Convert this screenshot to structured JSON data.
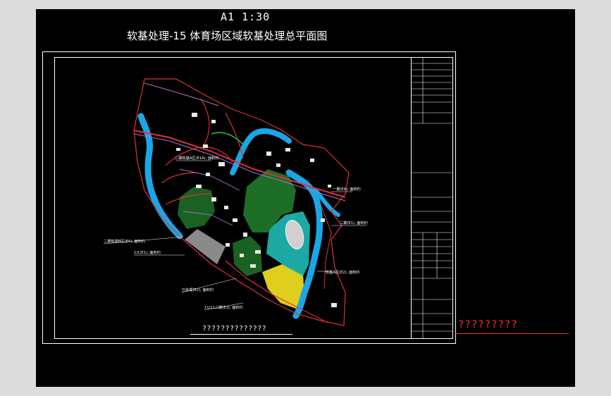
{
  "sheet": {
    "scale_label": "A1 1:30",
    "title": "软基处理-15 体育场区域软基处理总平面图"
  },
  "plan": {
    "caption": "??????????????",
    "red_note": "?????????",
    "zone_labels": [
      "二期软基A区(E1A),  面积约",
      "二期软基B区(E4),  面积约",
      "1/1(E1),  面积约",
      "已处理(E2), 面积约",
      "11/11二期(E3), 面积约",
      "一期(E4), 面积约",
      "二期(E1), 面积约",
      "软基A区(E2), 面积约"
    ]
  },
  "colors": {
    "background": "#000000",
    "frame": "#ffffff",
    "road_red": "#e0303a",
    "water_blue": "#1aa6e6",
    "vegetation_green": "#2bbf3c",
    "zone_cyan": "#22c6c0",
    "zone_yellow": "#f2e020",
    "note_red": "#ff3030"
  }
}
